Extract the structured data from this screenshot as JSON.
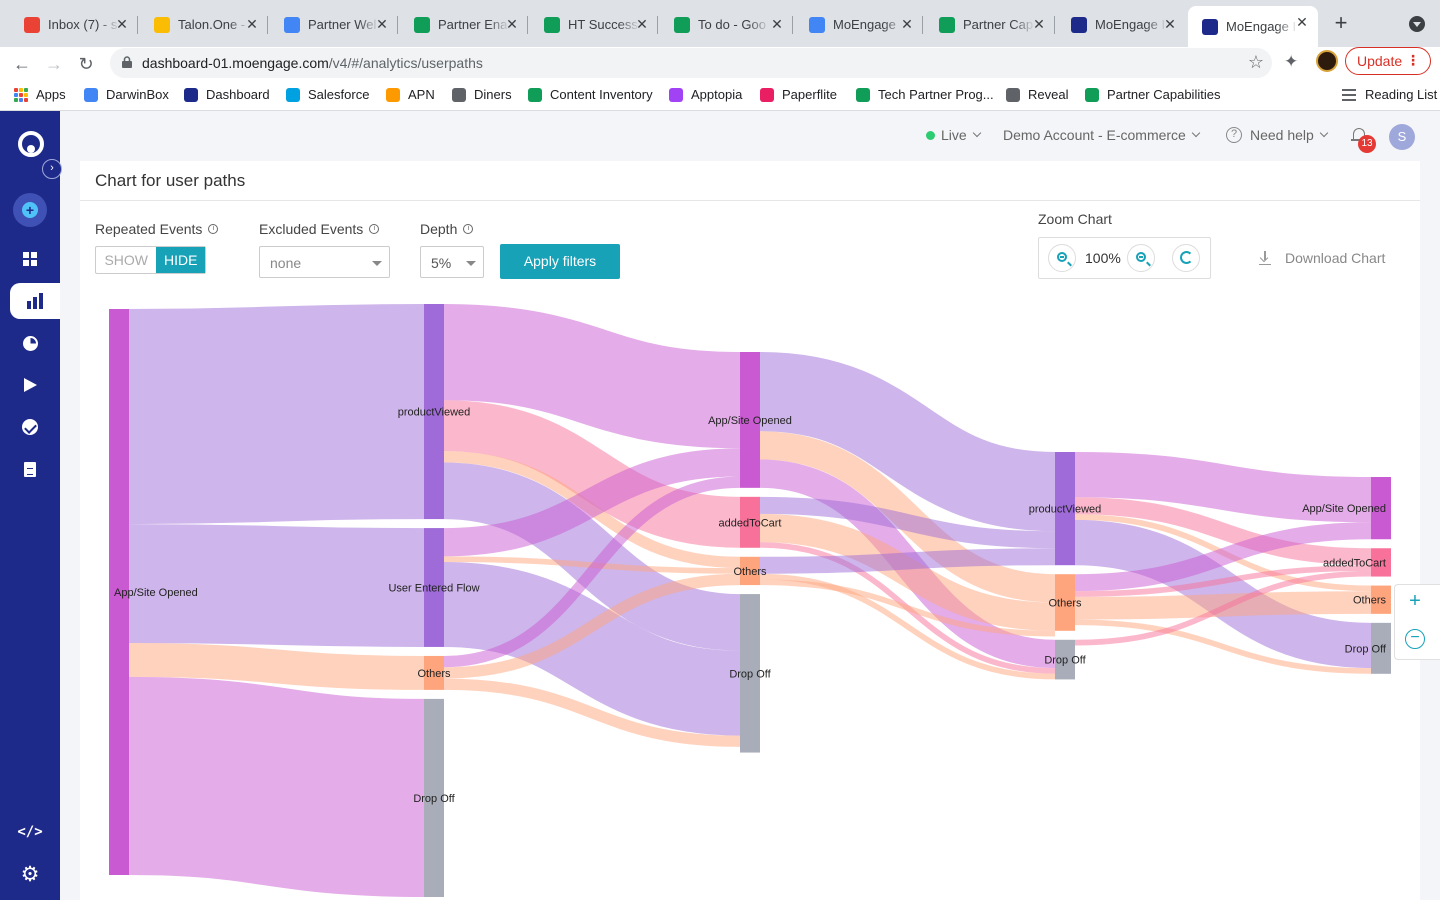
{
  "browser": {
    "tabs": [
      {
        "label": "Inbox (7) - s",
        "icon": "gmail-icon",
        "color": "#ea4335"
      },
      {
        "label": "Talon.One -",
        "icon": "drive-icon",
        "color": "#fbbc04"
      },
      {
        "label": "Partner Wel",
        "icon": "docs-icon",
        "color": "#4285f4"
      },
      {
        "label": "Partner Ena",
        "icon": "sheets-icon",
        "color": "#0f9d58"
      },
      {
        "label": "HT Success",
        "icon": "sheets-icon",
        "color": "#0f9d58"
      },
      {
        "label": "To do - Goo",
        "icon": "sheets-icon",
        "color": "#0f9d58"
      },
      {
        "label": "MoEngage",
        "icon": "calendar-icon",
        "color": "#4285f4"
      },
      {
        "label": "Partner Cap",
        "icon": "sheets-icon",
        "color": "#0f9d58"
      },
      {
        "label": "MoEngage I",
        "icon": "moengage-icon",
        "color": "#1e2a8a"
      },
      {
        "label": "MoEngage I",
        "icon": "moengage-icon",
        "color": "#1e2a8a",
        "active": true
      }
    ],
    "url_host": "dashboard-01.moengage.com",
    "url_path": "/v4/#/analytics/userpaths",
    "update_label": "Update",
    "bookmarks": [
      {
        "label": "Apps",
        "icon": "apps-grid-icon"
      },
      {
        "label": "DarwinBox",
        "icon": "google-icon",
        "color": "#4285f4"
      },
      {
        "label": "Dashboard",
        "icon": "moengage-icon",
        "color": "#1e2a8a"
      },
      {
        "label": "Salesforce",
        "icon": "salesforce-icon",
        "color": "#00a1e0"
      },
      {
        "label": "APN",
        "icon": "aws-icon",
        "color": "#ff9900"
      },
      {
        "label": "Diners",
        "icon": "diners-icon",
        "color": "#5f6368"
      },
      {
        "label": "Content Inventory",
        "icon": "sheets-icon",
        "color": "#0f9d58"
      },
      {
        "label": "Apptopia",
        "icon": "apptopia-icon",
        "color": "#a142f4"
      },
      {
        "label": "Paperflite",
        "icon": "paperflite-icon",
        "color": "#e91e63"
      },
      {
        "label": "Tech Partner Prog...",
        "icon": "sheets-icon",
        "color": "#0f9d58"
      },
      {
        "label": "Reveal",
        "icon": "reveal-icon",
        "color": "#5f6368"
      },
      {
        "label": "Partner Capabilities",
        "icon": "sheets-icon",
        "color": "#0f9d58"
      }
    ],
    "reading_list_label": "Reading List"
  },
  "topbar": {
    "live_label": "Live",
    "account_label": "Demo Account - E-commerce",
    "help_label": "Need help",
    "notification_count": "13",
    "avatar_initial": "S"
  },
  "page": {
    "title": "Chart for user paths",
    "filters": {
      "repeated_label": "Repeated Events",
      "show_label": "SHOW",
      "hide_label": "HIDE",
      "excluded_label": "Excluded Events",
      "excluded_value": "none",
      "depth_label": "Depth",
      "depth_value": "5%",
      "apply_label": "Apply filters"
    },
    "zoom": {
      "label": "Zoom Chart",
      "value": "100%"
    },
    "download_label": "Download Chart"
  },
  "colors": {
    "accent": "#17a2b8",
    "sidebar": "#1e2a8a",
    "app_opened": "#c95ad1",
    "product_viewed": "#9e6bd8",
    "user_entered": "#9e6bd8",
    "added_to_cart": "#f7719a",
    "others": "#ffa57e",
    "drop_off": "#a9adb9"
  },
  "chart_data": {
    "type": "sankey",
    "steps": 5,
    "nodes": [
      {
        "id": "s1_app",
        "label": "App/Site Opened",
        "step": 1,
        "value": 100,
        "color": "#c95ad1"
      },
      {
        "id": "s2_pv",
        "label": "productViewed",
        "step": 2,
        "value": 38,
        "color": "#9e6bd8"
      },
      {
        "id": "s2_uef",
        "label": "User Entered Flow",
        "step": 2,
        "value": 21,
        "color": "#9e6bd8"
      },
      {
        "id": "s2_oth",
        "label": "Others",
        "step": 2,
        "value": 6,
        "color": "#ffa57e"
      },
      {
        "id": "s2_drop",
        "label": "Drop Off",
        "step": 2,
        "value": 35,
        "color": "#a9adb9"
      },
      {
        "id": "s3_app",
        "label": "App/Site Opened",
        "step": 3,
        "value": 24,
        "color": "#c95ad1"
      },
      {
        "id": "s3_atc",
        "label": "addedToCart",
        "step": 3,
        "value": 9,
        "color": "#f7719a"
      },
      {
        "id": "s3_oth",
        "label": "Others",
        "step": 3,
        "value": 5,
        "color": "#ffa57e"
      },
      {
        "id": "s3_drop",
        "label": "Drop Off",
        "step": 3,
        "value": 28,
        "color": "#a9adb9"
      },
      {
        "id": "s4_pv",
        "label": "productViewed",
        "step": 4,
        "value": 20,
        "color": "#9e6bd8"
      },
      {
        "id": "s4_oth",
        "label": "Others",
        "step": 4,
        "value": 10,
        "color": "#ffa57e"
      },
      {
        "id": "s4_drop",
        "label": "Drop Off",
        "step": 4,
        "value": 7,
        "color": "#a9adb9"
      },
      {
        "id": "s5_app",
        "label": "App/Site Opened",
        "step": 5,
        "value": 11,
        "color": "#c95ad1"
      },
      {
        "id": "s5_atc",
        "label": "addedToCart",
        "step": 5,
        "value": 5,
        "color": "#f7719a"
      },
      {
        "id": "s5_oth",
        "label": "Others",
        "step": 5,
        "value": 5,
        "color": "#ffa57e"
      },
      {
        "id": "s5_drop",
        "label": "Drop Off",
        "step": 5,
        "value": 9,
        "color": "#a9adb9"
      }
    ],
    "links": [
      {
        "source": "s1_app",
        "target": "s2_pv",
        "value": 38
      },
      {
        "source": "s1_app",
        "target": "s2_uef",
        "value": 21
      },
      {
        "source": "s1_app",
        "target": "s2_oth",
        "value": 6
      },
      {
        "source": "s1_app",
        "target": "s2_drop",
        "value": 35
      },
      {
        "source": "s2_pv",
        "target": "s3_app",
        "value": 17
      },
      {
        "source": "s2_pv",
        "target": "s3_atc",
        "value": 9
      },
      {
        "source": "s2_pv",
        "target": "s3_oth",
        "value": 2
      },
      {
        "source": "s2_pv",
        "target": "s3_drop",
        "value": 10
      },
      {
        "source": "s2_uef",
        "target": "s3_app",
        "value": 5
      },
      {
        "source": "s2_uef",
        "target": "s3_oth",
        "value": 1
      },
      {
        "source": "s2_uef",
        "target": "s3_drop",
        "value": 15
      },
      {
        "source": "s2_oth",
        "target": "s3_app",
        "value": 2
      },
      {
        "source": "s2_oth",
        "target": "s3_oth",
        "value": 2
      },
      {
        "source": "s2_oth",
        "target": "s3_drop",
        "value": 2
      },
      {
        "source": "s3_app",
        "target": "s4_pv",
        "value": 14
      },
      {
        "source": "s3_app",
        "target": "s4_oth",
        "value": 5
      },
      {
        "source": "s3_app",
        "target": "s4_drop",
        "value": 5
      },
      {
        "source": "s3_atc",
        "target": "s4_pv",
        "value": 3
      },
      {
        "source": "s3_atc",
        "target": "s4_oth",
        "value": 5
      },
      {
        "source": "s3_atc",
        "target": "s4_drop",
        "value": 1
      },
      {
        "source": "s3_oth",
        "target": "s4_pv",
        "value": 3
      },
      {
        "source": "s3_oth",
        "target": "s4_drop",
        "value": 1
      },
      {
        "source": "s3_oth",
        "target": "s4_oth",
        "value": 1
      },
      {
        "source": "s4_pv",
        "target": "s5_app",
        "value": 8
      },
      {
        "source": "s4_pv",
        "target": "s5_atc",
        "value": 3
      },
      {
        "source": "s4_pv",
        "target": "s5_oth",
        "value": 1
      },
      {
        "source": "s4_pv",
        "target": "s5_drop",
        "value": 8
      },
      {
        "source": "s4_oth",
        "target": "s5_app",
        "value": 3
      },
      {
        "source": "s4_oth",
        "target": "s5_atc",
        "value": 1
      },
      {
        "source": "s4_oth",
        "target": "s5_oth",
        "value": 4
      },
      {
        "source": "s4_oth",
        "target": "s5_drop",
        "value": 1
      },
      {
        "source": "s4_drop",
        "target": "s5_atc",
        "value": 1
      }
    ]
  }
}
